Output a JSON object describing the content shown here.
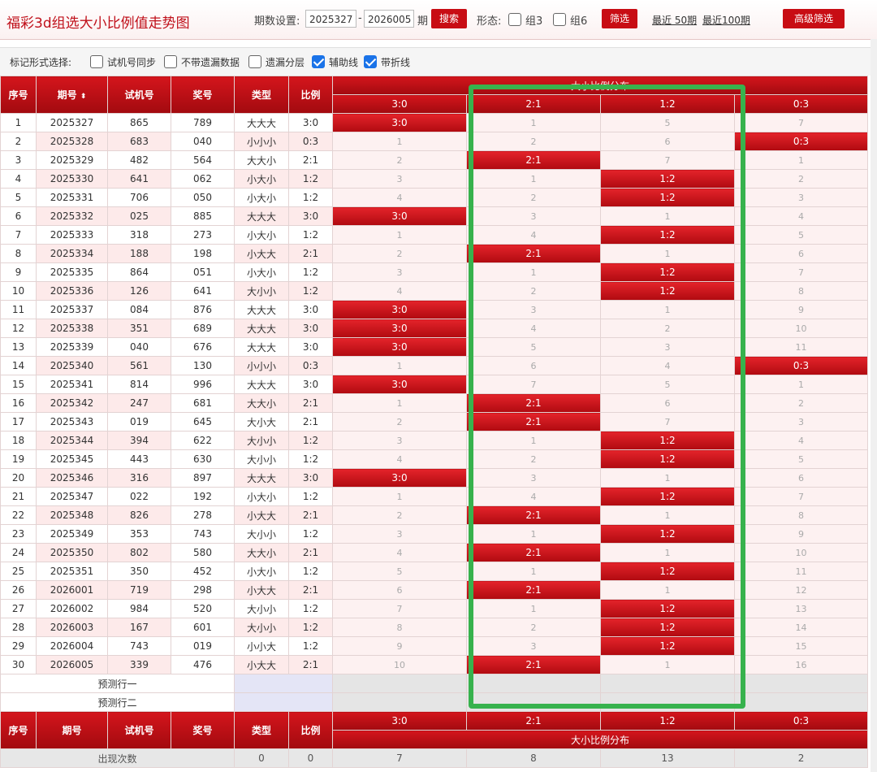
{
  "title": "福彩3d组选大小比例值走势图",
  "controls": {
    "period_label": "期数设置:",
    "period_from": "2025327",
    "dash": "-",
    "period_to": "2026005",
    "period_unit": "期",
    "search_label": "搜索",
    "form_label": "形态:",
    "zu3_label": "组3",
    "zu6_label": "组6",
    "filter_label": "筛选",
    "recent50": "最近 50期",
    "recent100": "最近100期",
    "advanced_label": "高级筛选"
  },
  "markbar": {
    "label": "标记形式选择:",
    "opt1": "试机号同步",
    "opt2": "不带遗漏数据",
    "opt3": "遗漏分层",
    "opt4": "辅助线",
    "opt5": "带折线"
  },
  "header": {
    "seq": "序号",
    "period": "期号",
    "sort": "排序",
    "trial": "试机号",
    "prize": "奖号",
    "type": "类型",
    "ratio": "比例",
    "dist_title": "大小比例分布",
    "cols": [
      "3:0",
      "2:1",
      "1:2",
      "0:3"
    ]
  },
  "rows": [
    {
      "seq": "1",
      "period": "2025327",
      "trial": "865",
      "prize": "789",
      "type": "大大大",
      "ratio": "3:0",
      "c": [
        "3:0",
        "1",
        "5",
        "7"
      ]
    },
    {
      "seq": "2",
      "period": "2025328",
      "trial": "683",
      "prize": "040",
      "type": "小小小",
      "ratio": "0:3",
      "c": [
        "1",
        "2",
        "6",
        "0:3"
      ]
    },
    {
      "seq": "3",
      "period": "2025329",
      "trial": "482",
      "prize": "564",
      "type": "大大小",
      "ratio": "2:1",
      "c": [
        "2",
        "2:1",
        "7",
        "1"
      ]
    },
    {
      "seq": "4",
      "period": "2025330",
      "trial": "641",
      "prize": "062",
      "type": "小大小",
      "ratio": "1:2",
      "c": [
        "3",
        "1",
        "1:2",
        "2"
      ]
    },
    {
      "seq": "5",
      "period": "2025331",
      "trial": "706",
      "prize": "050",
      "type": "小大小",
      "ratio": "1:2",
      "c": [
        "4",
        "2",
        "1:2",
        "3"
      ]
    },
    {
      "seq": "6",
      "period": "2025332",
      "trial": "025",
      "prize": "885",
      "type": "大大大",
      "ratio": "3:0",
      "c": [
        "3:0",
        "3",
        "1",
        "4"
      ]
    },
    {
      "seq": "7",
      "period": "2025333",
      "trial": "318",
      "prize": "273",
      "type": "小大小",
      "ratio": "1:2",
      "c": [
        "1",
        "4",
        "1:2",
        "5"
      ]
    },
    {
      "seq": "8",
      "period": "2025334",
      "trial": "188",
      "prize": "198",
      "type": "小大大",
      "ratio": "2:1",
      "c": [
        "2",
        "2:1",
        "1",
        "6"
      ]
    },
    {
      "seq": "9",
      "period": "2025335",
      "trial": "864",
      "prize": "051",
      "type": "小大小",
      "ratio": "1:2",
      "c": [
        "3",
        "1",
        "1:2",
        "7"
      ]
    },
    {
      "seq": "10",
      "period": "2025336",
      "trial": "126",
      "prize": "641",
      "type": "大小小",
      "ratio": "1:2",
      "c": [
        "4",
        "2",
        "1:2",
        "8"
      ]
    },
    {
      "seq": "11",
      "period": "2025337",
      "trial": "084",
      "prize": "876",
      "type": "大大大",
      "ratio": "3:0",
      "c": [
        "3:0",
        "3",
        "1",
        "9"
      ]
    },
    {
      "seq": "12",
      "period": "2025338",
      "trial": "351",
      "prize": "689",
      "type": "大大大",
      "ratio": "3:0",
      "c": [
        "3:0",
        "4",
        "2",
        "10"
      ]
    },
    {
      "seq": "13",
      "period": "2025339",
      "trial": "040",
      "prize": "676",
      "type": "大大大",
      "ratio": "3:0",
      "c": [
        "3:0",
        "5",
        "3",
        "11"
      ]
    },
    {
      "seq": "14",
      "period": "2025340",
      "trial": "561",
      "prize": "130",
      "type": "小小小",
      "ratio": "0:3",
      "c": [
        "1",
        "6",
        "4",
        "0:3"
      ]
    },
    {
      "seq": "15",
      "period": "2025341",
      "trial": "814",
      "prize": "996",
      "type": "大大大",
      "ratio": "3:0",
      "c": [
        "3:0",
        "7",
        "5",
        "1"
      ]
    },
    {
      "seq": "16",
      "period": "2025342",
      "trial": "247",
      "prize": "681",
      "type": "大大小",
      "ratio": "2:1",
      "c": [
        "1",
        "2:1",
        "6",
        "2"
      ]
    },
    {
      "seq": "17",
      "period": "2025343",
      "trial": "019",
      "prize": "645",
      "type": "大小大",
      "ratio": "2:1",
      "c": [
        "2",
        "2:1",
        "7",
        "3"
      ]
    },
    {
      "seq": "18",
      "period": "2025344",
      "trial": "394",
      "prize": "622",
      "type": "大小小",
      "ratio": "1:2",
      "c": [
        "3",
        "1",
        "1:2",
        "4"
      ]
    },
    {
      "seq": "19",
      "period": "2025345",
      "trial": "443",
      "prize": "630",
      "type": "大小小",
      "ratio": "1:2",
      "c": [
        "4",
        "2",
        "1:2",
        "5"
      ]
    },
    {
      "seq": "20",
      "period": "2025346",
      "trial": "316",
      "prize": "897",
      "type": "大大大",
      "ratio": "3:0",
      "c": [
        "3:0",
        "3",
        "1",
        "6"
      ]
    },
    {
      "seq": "21",
      "period": "2025347",
      "trial": "022",
      "prize": "192",
      "type": "小大小",
      "ratio": "1:2",
      "c": [
        "1",
        "4",
        "1:2",
        "7"
      ]
    },
    {
      "seq": "22",
      "period": "2025348",
      "trial": "826",
      "prize": "278",
      "type": "小大大",
      "ratio": "2:1",
      "c": [
        "2",
        "2:1",
        "1",
        "8"
      ]
    },
    {
      "seq": "23",
      "period": "2025349",
      "trial": "353",
      "prize": "743",
      "type": "大小小",
      "ratio": "1:2",
      "c": [
        "3",
        "1",
        "1:2",
        "9"
      ]
    },
    {
      "seq": "24",
      "period": "2025350",
      "trial": "802",
      "prize": "580",
      "type": "大大小",
      "ratio": "2:1",
      "c": [
        "4",
        "2:1",
        "1",
        "10"
      ]
    },
    {
      "seq": "25",
      "period": "2025351",
      "trial": "350",
      "prize": "452",
      "type": "小大小",
      "ratio": "1:2",
      "c": [
        "5",
        "1",
        "1:2",
        "11"
      ]
    },
    {
      "seq": "26",
      "period": "2026001",
      "trial": "719",
      "prize": "298",
      "type": "小大大",
      "ratio": "2:1",
      "c": [
        "6",
        "2:1",
        "1",
        "12"
      ]
    },
    {
      "seq": "27",
      "period": "2026002",
      "trial": "984",
      "prize": "520",
      "type": "大小小",
      "ratio": "1:2",
      "c": [
        "7",
        "1",
        "1:2",
        "13"
      ]
    },
    {
      "seq": "28",
      "period": "2026003",
      "trial": "167",
      "prize": "601",
      "type": "大小小",
      "ratio": "1:2",
      "c": [
        "8",
        "2",
        "1:2",
        "14"
      ]
    },
    {
      "seq": "29",
      "period": "2026004",
      "trial": "743",
      "prize": "019",
      "type": "小小大",
      "ratio": "1:2",
      "c": [
        "9",
        "3",
        "1:2",
        "15"
      ]
    },
    {
      "seq": "30",
      "period": "2026005",
      "trial": "339",
      "prize": "476",
      "type": "小大大",
      "ratio": "2:1",
      "c": [
        "10",
        "2:1",
        "1",
        "16"
      ]
    }
  ],
  "predict": [
    "预测行一",
    "预测行二"
  ],
  "footer": {
    "label": "出现次数",
    "type_count": "0",
    "ratio_count": "0",
    "counts": [
      "7",
      "8",
      "13",
      "2"
    ]
  }
}
